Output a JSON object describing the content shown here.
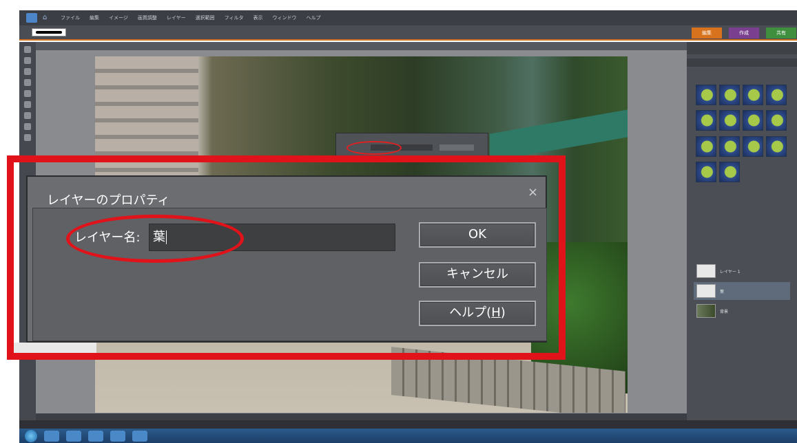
{
  "menubar": {
    "items": [
      "ファイル",
      "編集",
      "イメージ",
      "画質調整",
      "レイヤー",
      "選択範囲",
      "フィルタ",
      "表示",
      "ウィンドウ",
      "ヘルプ"
    ]
  },
  "modes": {
    "edit": "編集",
    "create": "作成",
    "share": "共有"
  },
  "dialog": {
    "title": "レイヤーのプロパティ",
    "close_icon": "×",
    "name_label": "レイヤー名:",
    "name_value": "葉",
    "ok_label": "OK",
    "cancel_label": "キャンセル",
    "help_label": "ヘルプ(",
    "help_key": "H",
    "help_tail": ")"
  },
  "layers": {
    "rows": [
      {
        "name": "レイヤー 1"
      },
      {
        "name": "葉"
      },
      {
        "name": "背景"
      }
    ]
  },
  "colors": {
    "highlight": "#e0131b",
    "dialog_bg": "#6b6d70",
    "accent": "#d9721c"
  }
}
